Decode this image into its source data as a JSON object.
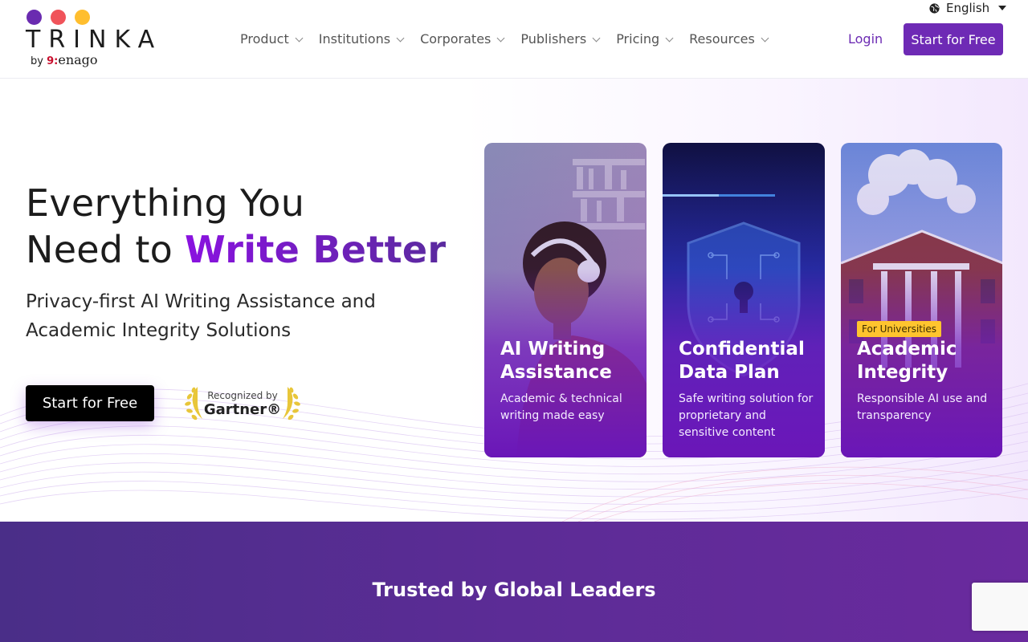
{
  "brand": {
    "wordmark": "TRINKA",
    "by": "by",
    "parent": "enago",
    "parent_mark": "9:",
    "dot_colors": [
      "#6a2bb0",
      "#f0535a",
      "#ffbe2e"
    ]
  },
  "header": {
    "language": "English",
    "nav": [
      {
        "label": "Product"
      },
      {
        "label": "Institutions"
      },
      {
        "label": "Corporates"
      },
      {
        "label": "Publishers"
      },
      {
        "label": "Pricing"
      },
      {
        "label": "Resources"
      }
    ],
    "login": "Login",
    "cta": "Start for Free"
  },
  "hero": {
    "title_line1": "Everything You",
    "title_line2_plain": "Need to ",
    "title_line2_highlight": "Write Better",
    "subtitle": "Privacy-first AI Writing Assistance and Academic Integrity Solutions",
    "cta": "Start for Free",
    "gartner_recognized": "Recognized by",
    "gartner_name": "Gartner®"
  },
  "cards": [
    {
      "title": "AI Writing Assistance",
      "description": "Academic & technical writing made easy",
      "badge": ""
    },
    {
      "title": "Confidential Data Plan",
      "description": "Safe writing solution for proprietary and sensitive content",
      "badge": ""
    },
    {
      "title": "Academic Integrity",
      "description": "Responsible AI use and transparency",
      "badge": "For Universities"
    }
  ],
  "trusted": {
    "title": "Trusted by Global Leaders"
  },
  "colors": {
    "brand_purple": "#6e2ab5",
    "highlight_start": "#8a12e0",
    "highlight_end": "#5a2a9e",
    "badge_yellow": "#ffc42e"
  }
}
